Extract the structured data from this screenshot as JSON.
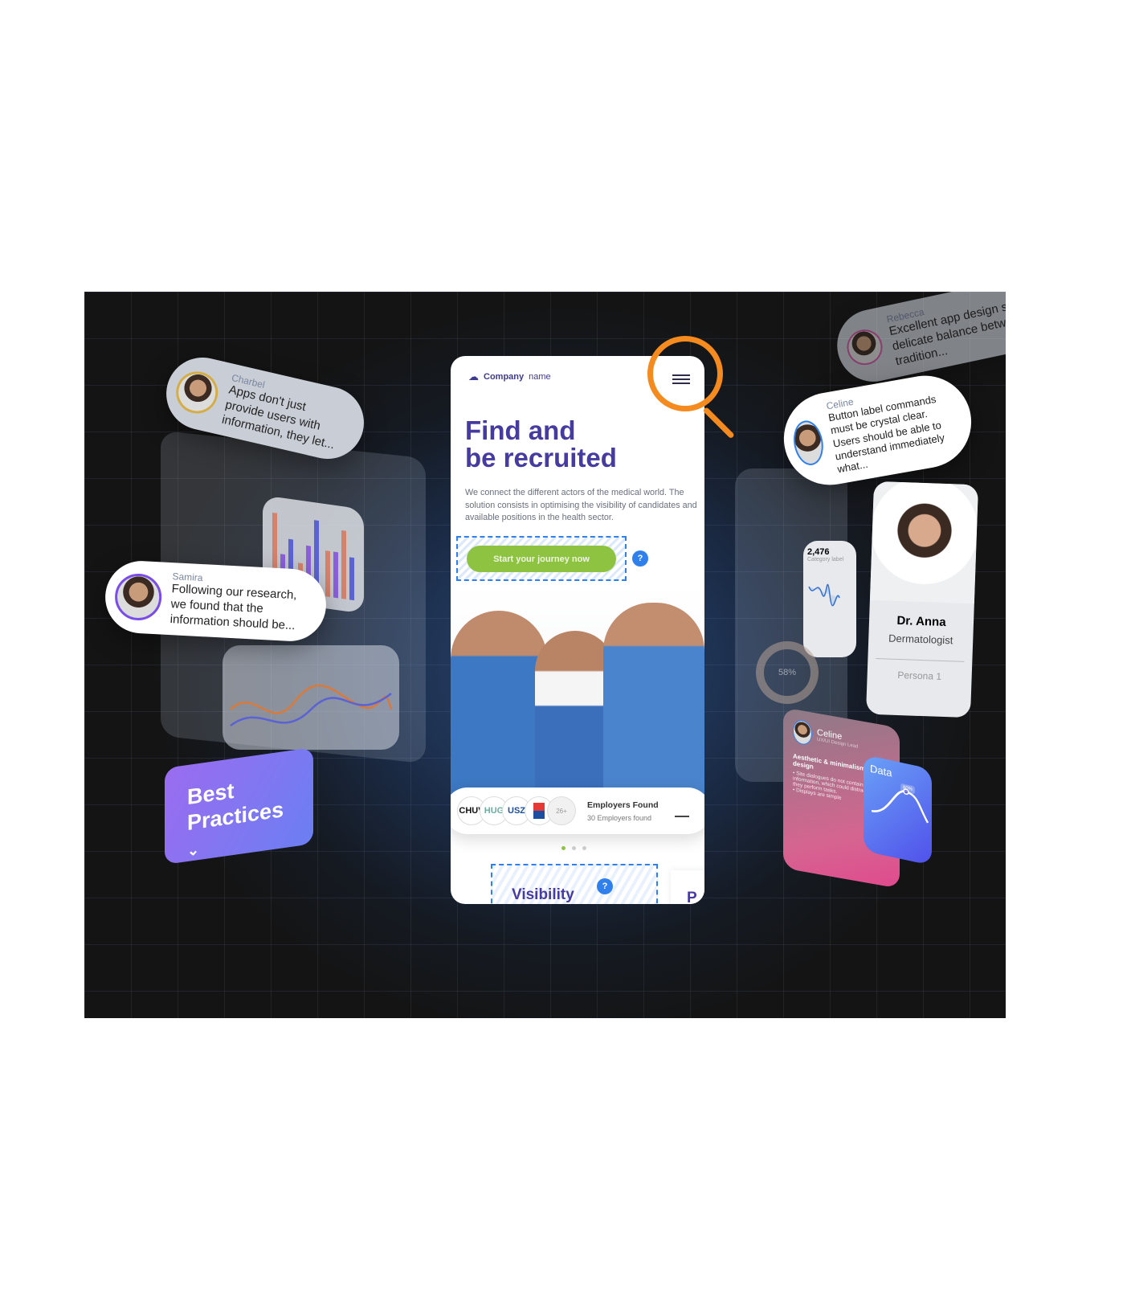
{
  "phone": {
    "logo_bold": "Company",
    "logo_light": "name",
    "headline_line1": "Find and",
    "headline_line2": "be recruited",
    "description": "We connect the different actors of the medical world. The solution consists in optimising the visibility of candidates and available positions in the health sector.",
    "cta_label": "Start your journey now",
    "help": "?",
    "employers": {
      "logos": [
        "CHUV",
        "HUG",
        "USZ",
        "",
        "26+"
      ],
      "title": "Employers Found",
      "subtitle": "30 Employers found"
    },
    "section_label": "Visibility",
    "next_section_initial": "P"
  },
  "testimonials": [
    {
      "name": "Charbel",
      "text": "Apps don't just provide users with information, they let..."
    },
    {
      "name": "Samira",
      "text": "Following our research, we found that the information should be..."
    },
    {
      "name": "Rebecca",
      "text": "Excellent app design strikes a delicate balance between tradition..."
    },
    {
      "name": "Celine",
      "text": "Button label commands must be crystal clear. Users should be able to understand immediately what..."
    }
  ],
  "best_practices": {
    "label_line1": "Best",
    "label_line2": "Practices"
  },
  "stat_card": {
    "value": "2,476",
    "label": "Category label"
  },
  "donut": {
    "value": "58%"
  },
  "persona": {
    "name": "Dr. Anna",
    "role": "Dermatologist",
    "tag": "Persona 1"
  },
  "insight_card": {
    "name": "Celine",
    "role": "UX/UI Design Lead",
    "title": "Aesthetic & minimalism in design",
    "bullets": [
      "Site dialogues do not contain irrelevant information, which could distract users as they perform tasks.",
      "Displays are simple"
    ]
  },
  "data_card": {
    "title": "Data",
    "tooltip": "80%"
  },
  "colors": {
    "accent": "#453ba0",
    "cta": "#8ec241",
    "help": "#2f80ed",
    "magnifier": "#f58a1f"
  }
}
